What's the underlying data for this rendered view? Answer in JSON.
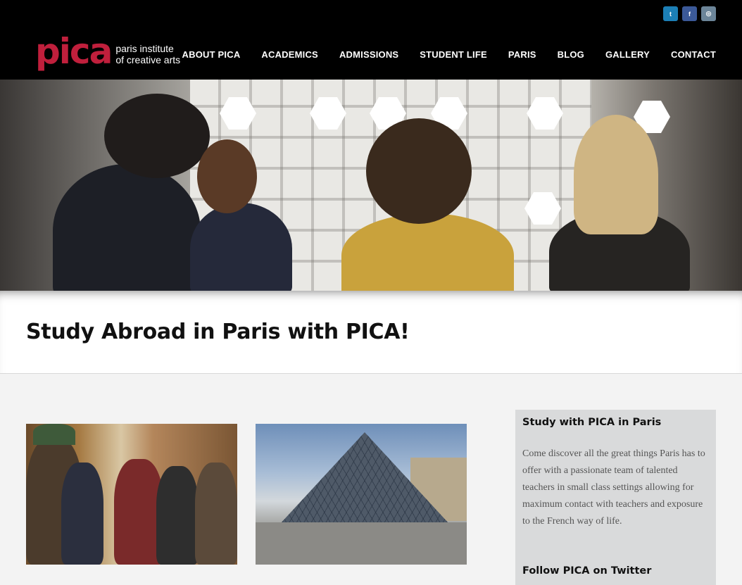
{
  "social": {
    "twitter": "t",
    "facebook": "f",
    "instagram": "◎"
  },
  "logo": {
    "mark": "pica",
    "line1": "paris institute",
    "line2": "of creative arts"
  },
  "nav": [
    "ABOUT PICA",
    "ACADEMICS",
    "ADMISSIONS",
    "STUDENT LIFE",
    "PARIS",
    "BLOG",
    "GALLERY",
    "CONTACT"
  ],
  "page": {
    "title": "Study Abroad in Paris with PICA!"
  },
  "sidebar": {
    "title": "Study with PICA in Paris",
    "text": "Come discover all the great things Paris has to offer with a passionate team of talented teachers in small class settings allowing for maximum contact with teachers and exposure to the French way of life.",
    "twitter_title": "Follow PICA on Twitter"
  },
  "colors": {
    "brand": "#c01f3c",
    "header": "#000000",
    "sidebar_bg": "#d9dadb"
  }
}
